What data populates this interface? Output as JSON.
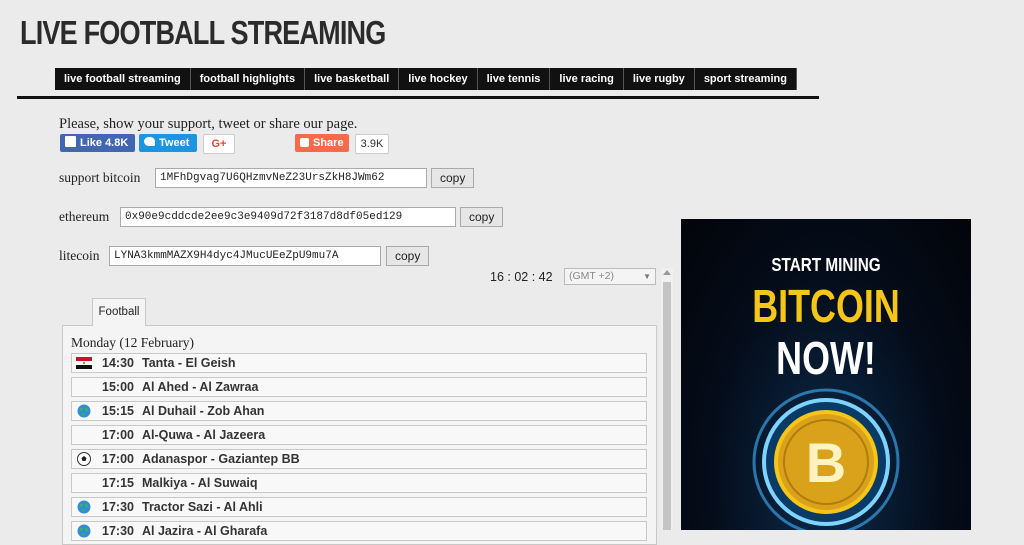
{
  "site": {
    "title": "LIVE FOOTBALL STREAMING"
  },
  "nav": {
    "items": [
      "live football streaming",
      "football highlights",
      "live basketball",
      "live hockey",
      "live tennis",
      "live racing",
      "live rugby",
      "sport streaming"
    ]
  },
  "support": {
    "message": "Please, show your support, tweet or share our page."
  },
  "share": {
    "like_label": "Like 4.8K",
    "tweet_label": "Tweet",
    "gplus_label": "G+",
    "share_label": "Share",
    "share_count": "3.9K"
  },
  "crypto": {
    "copy_label": "copy",
    "bitcoin": {
      "label": "support bitcoin",
      "address": "1MFhDgvag7U6QHzmvNeZ23UrsZkH8JWm62"
    },
    "ethereum": {
      "label": "ethereum",
      "address": "0x90e9cddcde2ee9c3e9409d72f3187d8df05ed129"
    },
    "litecoin": {
      "label": "litecoin",
      "address": "LYNA3kmmMAZX9H4dyc4JMucUEeZpU9mu7A"
    }
  },
  "clock": {
    "time": "16 : 02 : 42",
    "timezone": "(GMT +2)"
  },
  "schedule": {
    "tab_label": "Football",
    "day_heading": "Monday (12 February)",
    "matches": [
      {
        "time": "14:30",
        "teams": "Tanta - El Geish",
        "icon": "egypt-flag"
      },
      {
        "time": "15:00",
        "teams": "Al Ahed - Al Zawraa",
        "icon": "none"
      },
      {
        "time": "15:15",
        "teams": "Al Duhail - Zob Ahan",
        "icon": "globe"
      },
      {
        "time": "17:00",
        "teams": "Al-Quwa - Al Jazeera",
        "icon": "none"
      },
      {
        "time": "17:00",
        "teams": "Adanaspor - Gaziantep BB",
        "icon": "soccer-ball"
      },
      {
        "time": "17:15",
        "teams": "Malkiya - Al Suwaiq",
        "icon": "none"
      },
      {
        "time": "17:30",
        "teams": "Tractor Sazi - Al Ahli",
        "icon": "globe"
      },
      {
        "time": "17:30",
        "teams": "Al Jazira - Al Gharafa",
        "icon": "globe"
      }
    ]
  },
  "ad": {
    "line1": "START MINING",
    "line2": "BITCOIN",
    "line3": "NOW!",
    "coin_symbol": "B",
    "colors": {
      "gold": "#f5c518",
      "bg": "#050d1a",
      "glow": "#3fb6ff"
    }
  }
}
